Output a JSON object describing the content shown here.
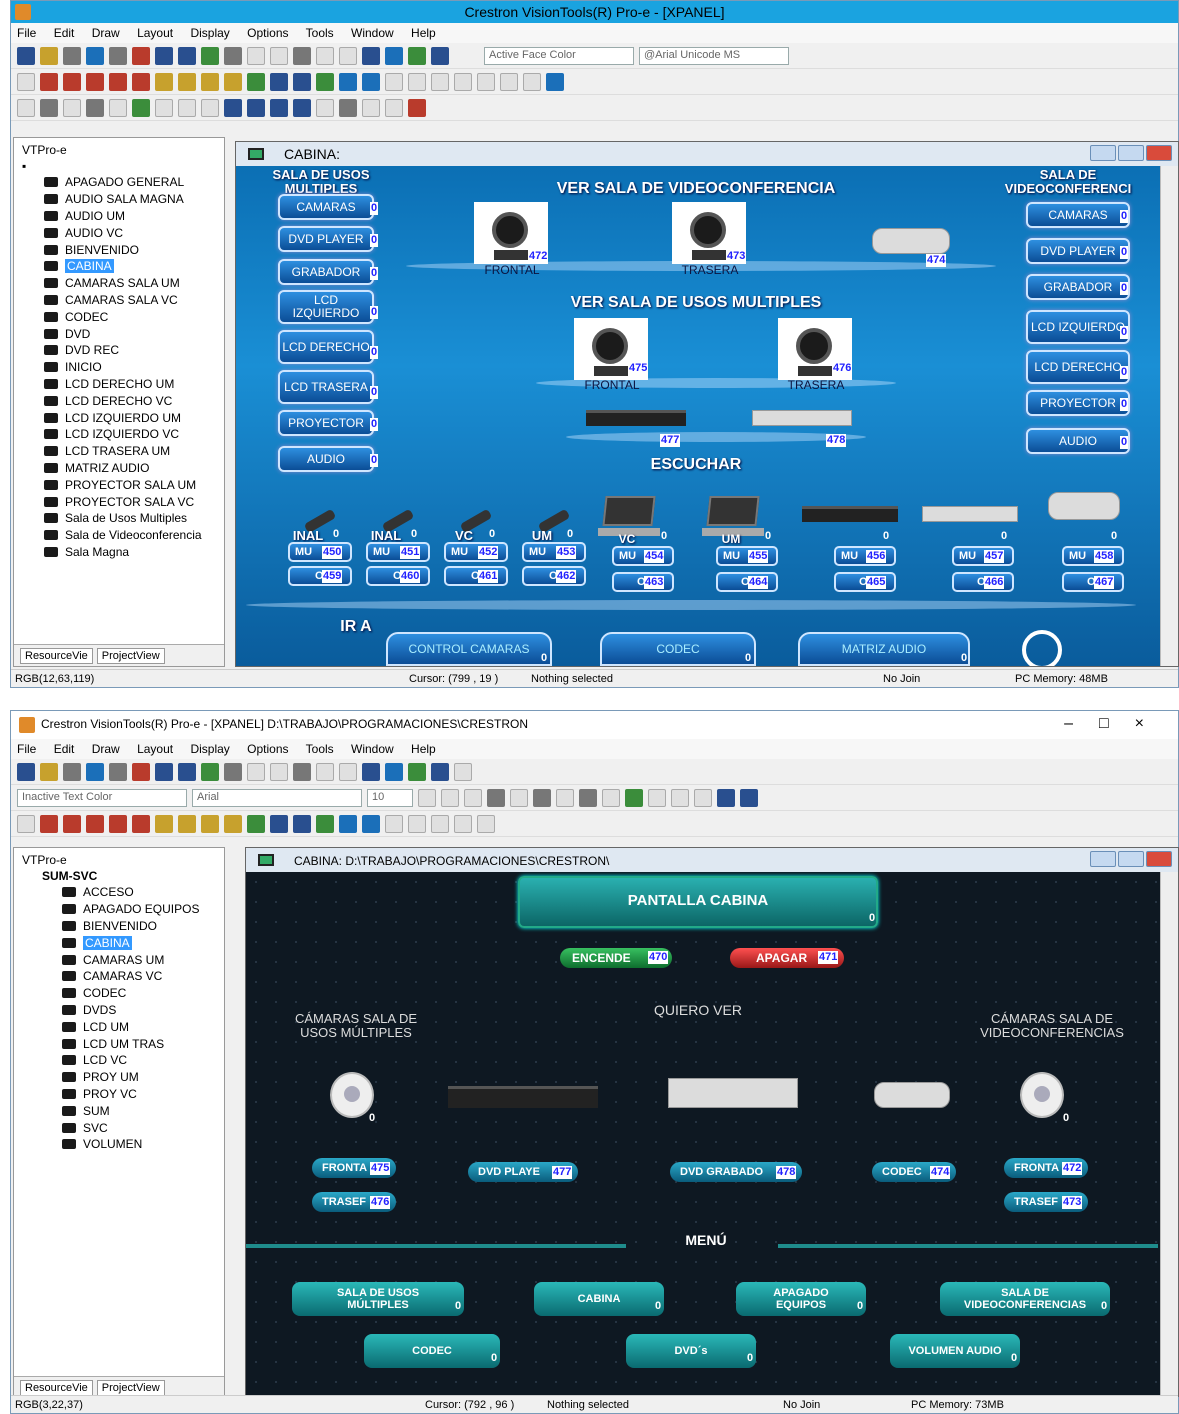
{
  "w1": {
    "title": "Crestron VisionTools(R) Pro-e - [XPANEL]",
    "menu": [
      "File",
      "Edit",
      "Draw",
      "Layout",
      "Display",
      "Options",
      "Tools",
      "Window",
      "Help"
    ],
    "face_color": "Active Face Color",
    "font": "@Arial Unicode MS",
    "tree_root": "VTPro-e",
    "tree": [
      "APAGADO GENERAL",
      "AUDIO SALA MAGNA",
      "AUDIO UM",
      "AUDIO VC",
      "BIENVENIDO",
      "CABINA",
      "CAMARAS SALA UM",
      "CAMARAS SALA VC",
      "CODEC",
      "DVD",
      "DVD REC",
      "INICIO",
      "LCD DERECHO UM",
      "LCD DERECHO VC",
      "LCD IZQUIERDO UM",
      "LCD IZQUIERDO VC",
      "LCD TRASERA UM",
      "MATRIZ AUDIO",
      "PROYECTOR SALA UM",
      "PROYECTOR SALA VC",
      "Sala de Usos Multiples",
      "Sala de Videoconferencia",
      "Sala Magna"
    ],
    "selected": "CABINA",
    "tab_resource": "ResourceVie",
    "tab_project": "ProjectView",
    "child_title": "CABINA:",
    "hdr_left": "SALA DE USOS MULTIPLES",
    "hdr_center": "VER SALA DE VIDEOCONFERENCIA",
    "hdr_right": "SALA DE VIDEOCONFERENCI",
    "hdr_um": "VER SALA DE USOS MULTIPLES",
    "escuchar": "ESCUCHAR",
    "ir_a": "IR A",
    "left_buttons": [
      "CAMARAS",
      "DVD PLAYER",
      "GRABADOR",
      "LCD IZQUIERDO",
      "LCD DERECHO",
      "LCD TRASERA",
      "PROYECTOR",
      "AUDIO"
    ],
    "right_buttons": [
      "CAMARAS",
      "DVD PLAYER",
      "GRABADOR",
      "LCD IZQUIERDO",
      "LCD DERECHO",
      "PROYECTOR",
      "AUDIO"
    ],
    "zero": "0",
    "cam_vc": [
      {
        "label": "FRONTAL",
        "join": "472"
      },
      {
        "label": "TRASERA",
        "join": "473"
      },
      {
        "label": "",
        "join": "474"
      }
    ],
    "cam_um": [
      {
        "label": "FRONTAL",
        "join": "475"
      },
      {
        "label": "TRASERA",
        "join": "476"
      }
    ],
    "dev_joins": [
      "477",
      "478"
    ],
    "mics": [
      {
        "label": "INAL",
        "mu": "450",
        "on": "459"
      },
      {
        "label": "INAL",
        "mu": "451",
        "on": "460"
      },
      {
        "label": "VC",
        "mu": "452",
        "on": "461"
      },
      {
        "label": "UM",
        "mu": "453",
        "on": "462"
      }
    ],
    "srcs": [
      {
        "label": "VC",
        "mu": "454",
        "on": "463"
      },
      {
        "label": "UM",
        "mu": "455",
        "on": "464"
      },
      {
        "label": "",
        "mu": "456",
        "on": "465"
      },
      {
        "label": "",
        "mu": "457",
        "on": "466"
      },
      {
        "label": "",
        "mu": "458",
        "on": "467"
      }
    ],
    "mu": "MU",
    "on": "O",
    "bottom": [
      "CONTROL CAMARAS",
      "CODEC",
      "MATRIZ AUDIO"
    ],
    "status_rgb": "RGB(12,63,119)",
    "status_cursor": "Cursor: (799 , 19 )",
    "status_sel": "Nothing selected",
    "status_join": "No Join",
    "status_mem": "PC Memory: 48MB"
  },
  "w2": {
    "title": "Crestron VisionTools(R) Pro-e - [XPANEL] D:\\TRABAJO\\PROGRAMACIONES\\CRESTRON",
    "menu": [
      "File",
      "Edit",
      "Draw",
      "Layout",
      "Display",
      "Options",
      "Tools",
      "Window",
      "Help"
    ],
    "text_color": "Inactive Text Color",
    "font": "Arial",
    "size": "10",
    "tree_root": "VTPro-e",
    "tree_group": "SUM-SVC",
    "tree": [
      "ACCESO",
      "APAGADO EQUIPOS",
      "BIENVENIDO",
      "CABINA",
      "CAMARAS UM",
      "CAMARAS VC",
      "CODEC",
      "DVDS",
      "LCD UM",
      "LCD UM TRAS",
      "LCD VC",
      "PROY UM",
      "PROY VC",
      "SUM",
      "SVC",
      "VOLUMEN"
    ],
    "selected": "CABINA",
    "tab_resource": "ResourceVie",
    "tab_project": "ProjectView",
    "child_title": "CABINA: D:\\TRABAJO\\PROGRAMACIONES\\CRESTRON\\",
    "pantalla": "PANTALLA CABINA",
    "enciende": "ENCENDE",
    "enciende_join": "470",
    "apagar": "APAGAR",
    "apagar_join": "471",
    "quiero_ver": "QUIERO VER",
    "cam_um_lbl": "CÁMARAS SALA DE USOS MÚLTIPLES",
    "cam_vc_lbl": "CÁMARAS SALA DE VIDEOCONFERENCIAS",
    "btns": [
      {
        "label": "FRONTA",
        "join": "475"
      },
      {
        "label": "TRASEF",
        "join": "476"
      },
      {
        "label": "DVD PLAYE",
        "join": "477"
      },
      {
        "label": "DVD GRABADO",
        "join": "478"
      },
      {
        "label": "CODEC",
        "join": "474"
      },
      {
        "label": "FRONTA",
        "join": "472"
      },
      {
        "label": "TRASEF",
        "join": "473"
      }
    ],
    "menu_title": "MENÚ",
    "menu_btns": [
      "SALA DE USOS MÚLTIPLES",
      "CABINA",
      "APAGADO EQUIPOS",
      "SALA DE VIDEOCONFERENCIAS",
      "CODEC",
      "DVD´s",
      "VOLUMEN AUDIO"
    ],
    "zero": "0",
    "status_rgb": "RGB(3,22,37)",
    "status_cursor": "Cursor: (792 , 96 )",
    "status_sel": "Nothing selected",
    "status_join": "No Join",
    "status_mem": "PC Memory: 73MB"
  }
}
